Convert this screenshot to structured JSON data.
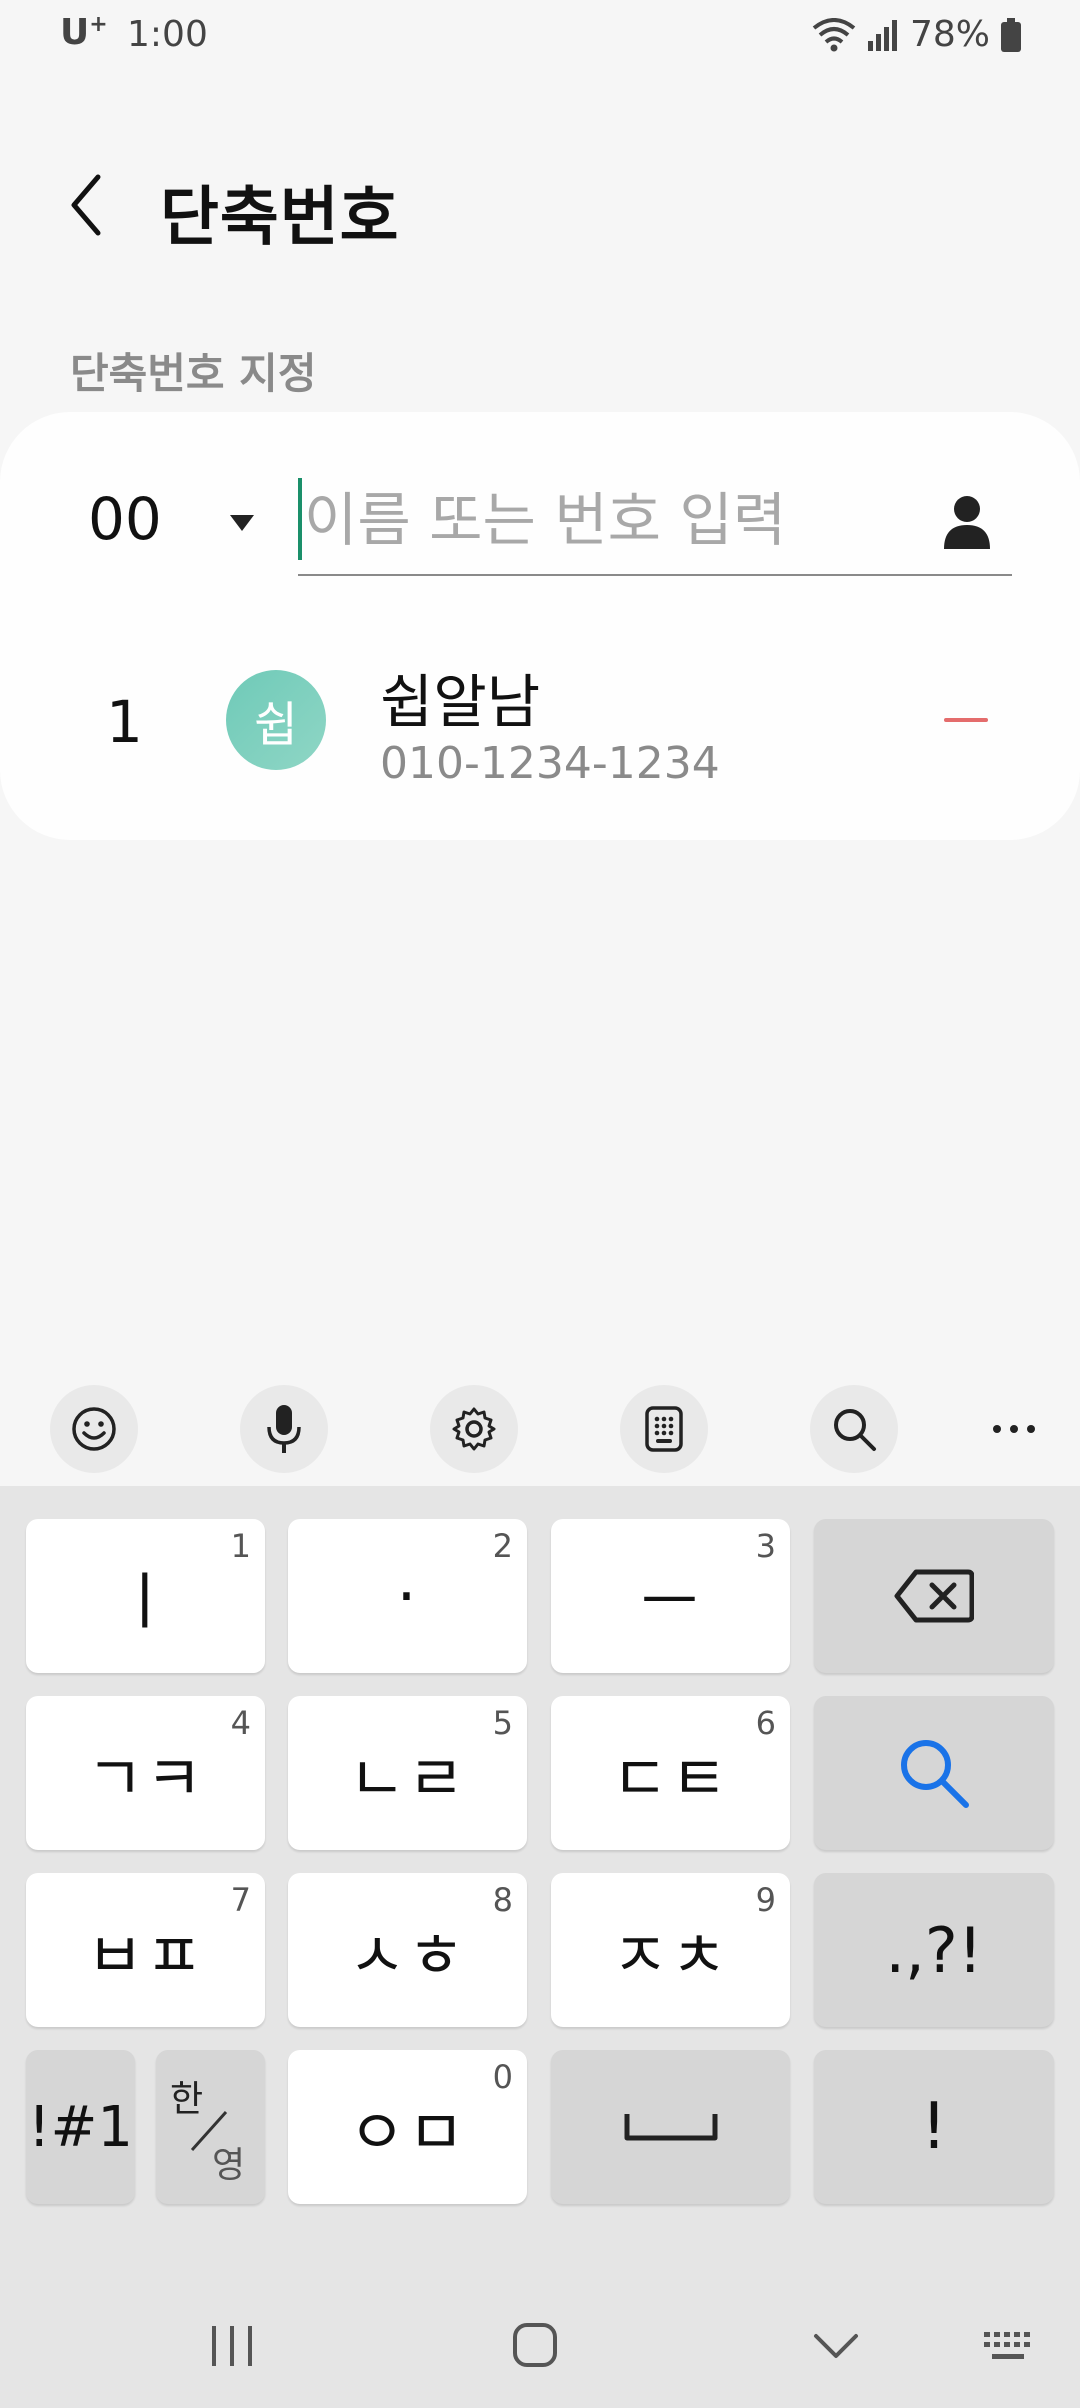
{
  "status_bar": {
    "carrier": "U",
    "carrier_sup": "+",
    "time": "1:00",
    "battery": "78%"
  },
  "header": {
    "title": "단축번호"
  },
  "section": {
    "label": "단축번호 지정"
  },
  "speed_dial_form": {
    "slot_value": "00",
    "input_placeholder": "이름 또는 번호 입력",
    "input_value": ""
  },
  "entries": [
    {
      "number": "1",
      "avatar_initial": "쉽",
      "name": "쉽알남",
      "phone": "010-1234-1234"
    }
  ],
  "keyboard": {
    "rows": [
      [
        {
          "label": "ㅣ",
          "hint": "1"
        },
        {
          "label": "·",
          "hint": "2"
        },
        {
          "label": "ㅡ",
          "hint": "3"
        }
      ],
      [
        {
          "label": "ㄱㅋ",
          "hint": "4"
        },
        {
          "label": "ㄴㄹ",
          "hint": "5"
        },
        {
          "label": "ㄷㅌ",
          "hint": "6"
        }
      ],
      [
        {
          "label": "ㅂㅍ",
          "hint": "7"
        },
        {
          "label": "ㅅㅎ",
          "hint": "8"
        },
        {
          "label": "ㅈㅊ",
          "hint": "9"
        }
      ]
    ],
    "punct_key": ".,?!",
    "symbols_key": "!#1",
    "lang_key_top": "한",
    "lang_key_bottom": "영",
    "bottom_key": {
      "label": "ㅇㅁ",
      "hint": "0"
    },
    "exclaim_key": "!"
  },
  "colors": {
    "accent": "#1a8f6a",
    "avatar": "#7ccfbe",
    "remove": "#e46c6c",
    "search_key": "#1a73e8"
  },
  "icons": [
    "back-arrow-icon",
    "dropdown-caret-icon",
    "contact-person-icon",
    "emoji-icon",
    "microphone-icon",
    "settings-icon",
    "keypad-icon",
    "search-icon",
    "more-icon",
    "backspace-icon",
    "space-icon"
  ]
}
